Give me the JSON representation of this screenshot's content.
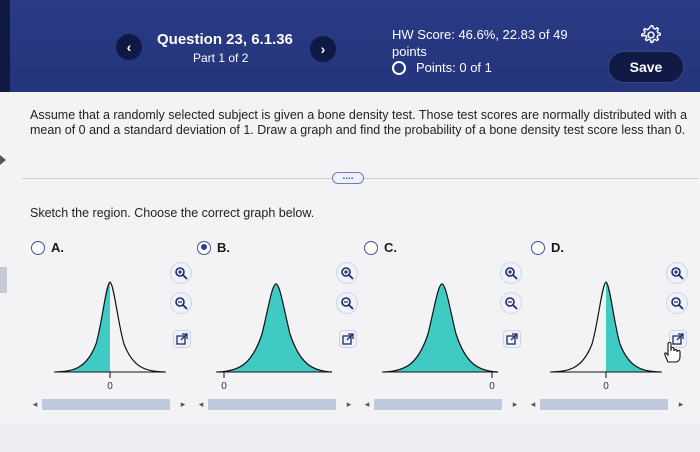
{
  "header": {
    "prev_icon": "‹",
    "next_icon": "›",
    "question_title": "Question 23, 6.1.36",
    "part": "Part 1 of 2",
    "hw_score": "HW Score: 46.6%, 22.83 of 49 points",
    "points": "Points: 0 of 1",
    "save_label": "Save",
    "settings_icon": "gear-icon"
  },
  "question": {
    "text": "Assume that a randomly selected subject is given a bone density test. Those test scores are normally distributed with a mean of 0 and a standard deviation of 1. Draw a graph and find the probability of a bone density test score less than 0.",
    "more_label": "....",
    "instruction": "Sketch the region. Choose the correct graph below."
  },
  "options": [
    {
      "label": "A.",
      "selected": false,
      "axis_label": "0"
    },
    {
      "label": "B.",
      "selected": true,
      "axis_label": "0"
    },
    {
      "label": "C.",
      "selected": false,
      "axis_label": "0"
    },
    {
      "label": "D.",
      "selected": false,
      "axis_label": "0"
    }
  ],
  "colors": {
    "header_bg": "#24357c",
    "shade": "#3fcbc4",
    "radio": "#2d3f93"
  }
}
